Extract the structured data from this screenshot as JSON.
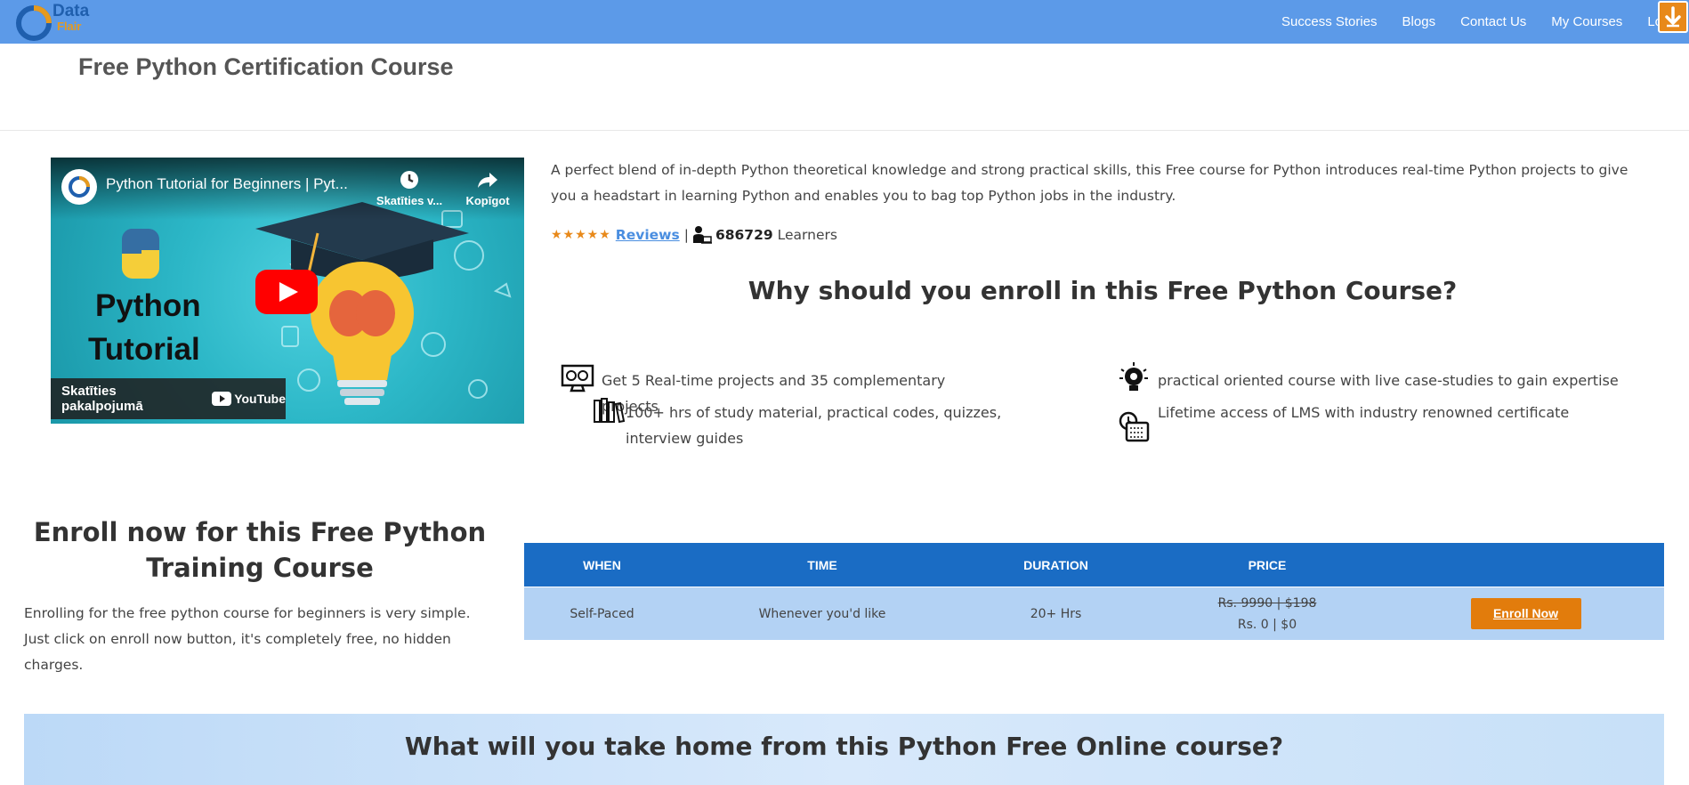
{
  "navbar": {
    "logo_text1": "Data",
    "logo_text2": "Flair",
    "links": [
      "Success Stories",
      "Blogs",
      "Contact Us",
      "My Courses",
      "Lo"
    ],
    "colors": {
      "bar": "#5c9ae8",
      "accent": "#e8891a"
    }
  },
  "page": {
    "title": "Free Python Certification Course"
  },
  "video": {
    "title": "Python Tutorial for Beginners | Pyt...",
    "watch_later": "Skatīties v...",
    "share": "Kopīgot",
    "big_text_1": "Python",
    "big_text_2": "Tutorial",
    "watch_on": "Skatīties pakalpojumā",
    "youtube": "YouTube"
  },
  "intro": {
    "description": "A perfect blend of in-depth Python theoretical knowledge and strong practical skills, this Free course for Python introduces real-time Python projects to give you a headstart in learning Python and enables you to bag top Python jobs in the industry.",
    "stars": "★★★★★",
    "reviews_label": "Reviews",
    "separator": "|",
    "learner_count": "686729",
    "learners_label": "Learners"
  },
  "why": {
    "heading": "Why should you enroll in this Free Python Course?",
    "features": [
      "Get 5 Real-time projects and 35 complementary projects",
      "100+ hrs of study material, practical codes, quizzes, interview guides",
      "practical oriented course with live case-studies to gain expertise",
      "Lifetime access of LMS with industry renowned certificate"
    ]
  },
  "enroll": {
    "heading": "Enroll now for this Free Python Training Course",
    "description": "Enrolling for the free python course for beginners is very simple. Just click on enroll now button, it's completely free, no hidden charges."
  },
  "schedule_table": {
    "headers": [
      "WHEN",
      "TIME",
      "DURATION",
      "PRICE",
      ""
    ],
    "row": {
      "when": "Self-Paced",
      "time": "Whenever you'd like",
      "duration": "20+ Hrs",
      "price_old": "Rs. 9990 | $198",
      "price_new": "Rs. 0 | $0",
      "button": "Enroll Now"
    }
  },
  "take_home": {
    "heading": "What will you take home from this Python Free Online course?"
  }
}
